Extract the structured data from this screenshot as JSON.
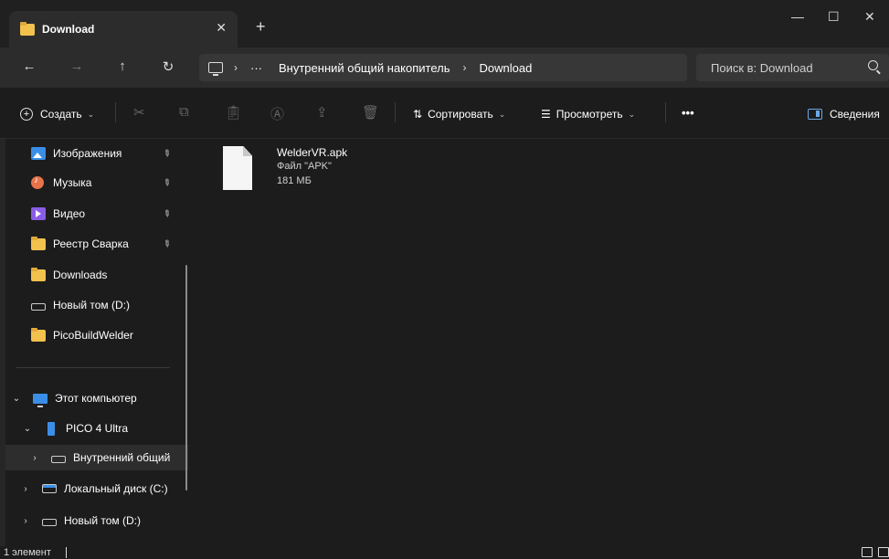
{
  "window": {
    "tab_title": "Download",
    "tab_close": "✕",
    "new_tab": "+",
    "minimize": "—",
    "maximize": "☐",
    "close": "✕"
  },
  "nav": {
    "back": "←",
    "forward": "→",
    "up": "↑",
    "refresh": "↻",
    "more": "···",
    "breadcrumb": [
      "Внутренний общий накопитель",
      "Download"
    ],
    "search_placeholder": "Поиск в: Download"
  },
  "toolbar": {
    "create_label": "Создать",
    "sort_label": "Сортировать",
    "view_label": "Просмотреть",
    "more": "•••",
    "details_label": "Сведения"
  },
  "sidebar": {
    "pinned": [
      {
        "label": "Изображения",
        "icon": "pictures-icon"
      },
      {
        "label": "Музыка",
        "icon": "music-icon"
      },
      {
        "label": "Видео",
        "icon": "videos-icon"
      },
      {
        "label": "Реестр Сварка",
        "icon": "folder-icon"
      }
    ],
    "recent": [
      {
        "label": "Downloads",
        "icon": "folder-icon"
      },
      {
        "label": "Новый том (D:)",
        "icon": "drive-icon"
      },
      {
        "label": "PicoBuildWelder",
        "icon": "folder-icon"
      }
    ],
    "tree": [
      {
        "label": "Этот компьютер",
        "icon": "computer-icon",
        "expanded": true
      },
      {
        "label": "PICO 4 Ultra",
        "icon": "device-icon",
        "expanded": true
      },
      {
        "label": "Внутренний общий",
        "icon": "drive-icon",
        "expanded": false,
        "selected": true
      },
      {
        "label": "Локальный диск (C:)",
        "icon": "system-drive-icon",
        "expanded": false
      },
      {
        "label": "Новый том (D:)",
        "icon": "drive-icon",
        "expanded": false
      }
    ]
  },
  "files": [
    {
      "name": "WelderVR.apk",
      "type": "Файл \"APK\"",
      "size": "181 МБ"
    }
  ],
  "status": {
    "count": "1 элемент"
  },
  "colors": {
    "background": "#1c1c1c",
    "titlebar": "#202020",
    "navbar": "#2c2c2c",
    "accent": "#3a8ee6",
    "folder": "#f2c14e"
  }
}
